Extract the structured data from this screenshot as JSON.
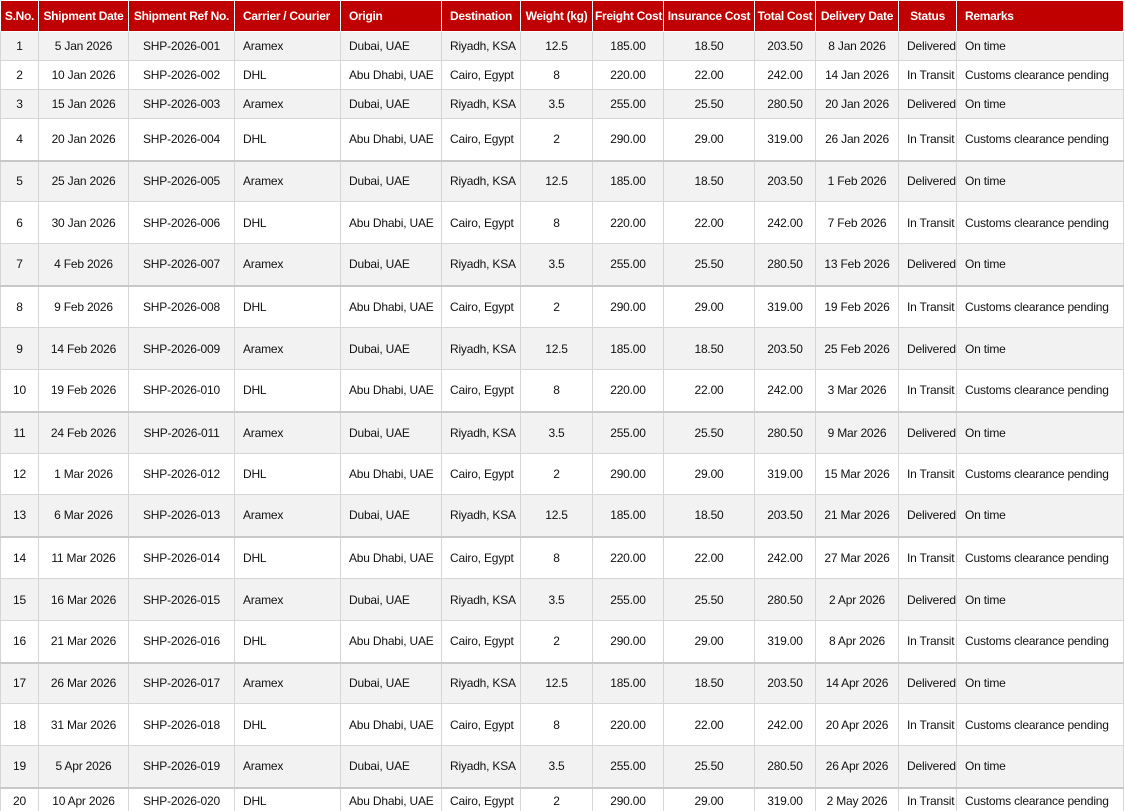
{
  "columns": [
    "S.No.",
    "Shipment Date",
    "Shipment Ref No.",
    "Carrier / Courier",
    "Origin",
    "Destination",
    "Weight (kg)",
    "Freight Cost",
    "Insurance Cost",
    "Total Cost",
    "Delivery Date",
    "Status",
    "Remarks"
  ],
  "rows": [
    [
      "1",
      "5 Jan 2026",
      "SHP-2026-001",
      "Aramex",
      "Dubai, UAE",
      "Riyadh, KSA",
      "12.5",
      "185.00",
      "18.50",
      "203.50",
      "8 Jan 2026",
      "Delivered",
      "On time"
    ],
    [
      "2",
      "10 Jan 2026",
      "SHP-2026-002",
      "DHL",
      "Abu Dhabi, UAE",
      "Cairo, Egypt",
      "8",
      "220.00",
      "22.00",
      "242.00",
      "14 Jan 2026",
      "In Transit",
      "Customs clearance pending"
    ],
    [
      "3",
      "15 Jan 2026",
      "SHP-2026-003",
      "Aramex",
      "Dubai, UAE",
      "Riyadh, KSA",
      "3.5",
      "255.00",
      "25.50",
      "280.50",
      "20 Jan 2026",
      "Delivered",
      "On time"
    ],
    [
      "4",
      "20 Jan 2026",
      "SHP-2026-004",
      "DHL",
      "Abu Dhabi, UAE",
      "Cairo, Egypt",
      "2",
      "290.00",
      "29.00",
      "319.00",
      "26 Jan 2026",
      "In Transit",
      "Customs clearance pending"
    ],
    [
      "5",
      "25 Jan 2026",
      "SHP-2026-005",
      "Aramex",
      "Dubai, UAE",
      "Riyadh, KSA",
      "12.5",
      "185.00",
      "18.50",
      "203.50",
      "1 Feb 2026",
      "Delivered",
      "On time"
    ],
    [
      "6",
      "30 Jan 2026",
      "SHP-2026-006",
      "DHL",
      "Abu Dhabi, UAE",
      "Cairo, Egypt",
      "8",
      "220.00",
      "22.00",
      "242.00",
      "7 Feb 2026",
      "In Transit",
      "Customs clearance pending"
    ],
    [
      "7",
      "4 Feb 2026",
      "SHP-2026-007",
      "Aramex",
      "Dubai, UAE",
      "Riyadh, KSA",
      "3.5",
      "255.00",
      "25.50",
      "280.50",
      "13 Feb 2026",
      "Delivered",
      "On time"
    ],
    [
      "8",
      "9 Feb 2026",
      "SHP-2026-008",
      "DHL",
      "Abu Dhabi, UAE",
      "Cairo, Egypt",
      "2",
      "290.00",
      "29.00",
      "319.00",
      "19 Feb 2026",
      "In Transit",
      "Customs clearance pending"
    ],
    [
      "9",
      "14 Feb 2026",
      "SHP-2026-009",
      "Aramex",
      "Dubai, UAE",
      "Riyadh, KSA",
      "12.5",
      "185.00",
      "18.50",
      "203.50",
      "25 Feb 2026",
      "Delivered",
      "On time"
    ],
    [
      "10",
      "19 Feb 2026",
      "SHP-2026-010",
      "DHL",
      "Abu Dhabi, UAE",
      "Cairo, Egypt",
      "8",
      "220.00",
      "22.00",
      "242.00",
      "3 Mar 2026",
      "In Transit",
      "Customs clearance pending"
    ],
    [
      "11",
      "24 Feb 2026",
      "SHP-2026-011",
      "Aramex",
      "Dubai, UAE",
      "Riyadh, KSA",
      "3.5",
      "255.00",
      "25.50",
      "280.50",
      "9 Mar 2026",
      "Delivered",
      "On time"
    ],
    [
      "12",
      "1 Mar 2026",
      "SHP-2026-012",
      "DHL",
      "Abu Dhabi, UAE",
      "Cairo, Egypt",
      "2",
      "290.00",
      "29.00",
      "319.00",
      "15 Mar 2026",
      "In Transit",
      "Customs clearance pending"
    ],
    [
      "13",
      "6 Mar 2026",
      "SHP-2026-013",
      "Aramex",
      "Dubai, UAE",
      "Riyadh, KSA",
      "12.5",
      "185.00",
      "18.50",
      "203.50",
      "21 Mar 2026",
      "Delivered",
      "On time"
    ],
    [
      "14",
      "11 Mar 2026",
      "SHP-2026-014",
      "DHL",
      "Abu Dhabi, UAE",
      "Cairo, Egypt",
      "8",
      "220.00",
      "22.00",
      "242.00",
      "27 Mar 2026",
      "In Transit",
      "Customs clearance pending"
    ],
    [
      "15",
      "16 Mar 2026",
      "SHP-2026-015",
      "Aramex",
      "Dubai, UAE",
      "Riyadh, KSA",
      "3.5",
      "255.00",
      "25.50",
      "280.50",
      "2 Apr 2026",
      "Delivered",
      "On time"
    ],
    [
      "16",
      "21 Mar 2026",
      "SHP-2026-016",
      "DHL",
      "Abu Dhabi, UAE",
      "Cairo, Egypt",
      "2",
      "290.00",
      "29.00",
      "319.00",
      "8 Apr 2026",
      "In Transit",
      "Customs clearance pending"
    ],
    [
      "17",
      "26 Mar 2026",
      "SHP-2026-017",
      "Aramex",
      "Dubai, UAE",
      "Riyadh, KSA",
      "12.5",
      "185.00",
      "18.50",
      "203.50",
      "14 Apr 2026",
      "Delivered",
      "On time"
    ],
    [
      "18",
      "31 Mar 2026",
      "SHP-2026-018",
      "DHL",
      "Abu Dhabi, UAE",
      "Cairo, Egypt",
      "8",
      "220.00",
      "22.00",
      "242.00",
      "20 Apr 2026",
      "In Transit",
      "Customs clearance pending"
    ],
    [
      "19",
      "5 Apr 2026",
      "SHP-2026-019",
      "Aramex",
      "Dubai, UAE",
      "Riyadh, KSA",
      "3.5",
      "255.00",
      "25.50",
      "280.50",
      "26 Apr 2026",
      "Delivered",
      "On time"
    ],
    [
      "20",
      "10 Apr 2026",
      "SHP-2026-020",
      "DHL",
      "Abu Dhabi, UAE",
      "Cairo, Egypt",
      "2",
      "290.00",
      "29.00",
      "319.00",
      "2 May 2026",
      "In Transit",
      "Customs clearance pending"
    ]
  ],
  "colors": {
    "header_background": "#c00000",
    "header_text": "#ffffff",
    "banded_row": "#f2f2f2",
    "gridline": "#d6d6d6"
  }
}
